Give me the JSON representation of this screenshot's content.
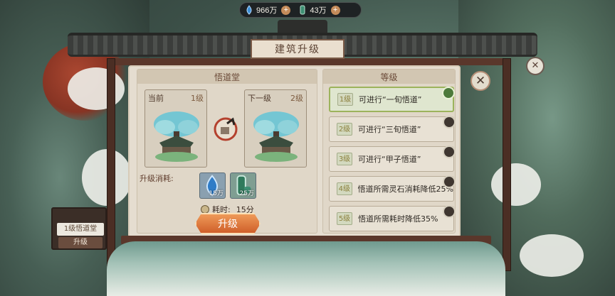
{
  "resources": [
    {
      "icon": "spirit-stone-icon",
      "value": "966万",
      "color": "#3d8fd6"
    },
    {
      "icon": "wood-log-icon",
      "value": "43万",
      "color": "#3e8f73"
    }
  ],
  "dialog": {
    "title": "建筑升级",
    "building_name": "悟道堂",
    "current_label": "当前",
    "current_level": "1级",
    "next_label": "下一级",
    "next_level": "2级",
    "cost_label": "升级消耗:",
    "costs": [
      {
        "icon": "spirit-stone-icon",
        "qty": "15万"
      },
      {
        "icon": "wood-log-icon",
        "qty": "25万"
      }
    ],
    "time_label": "耗时:",
    "time_value": "15分",
    "upgrade_button": "升级"
  },
  "levels_panel": {
    "header": "等级",
    "items": [
      {
        "level": "1级",
        "text": "可进行“一旬悟道”",
        "state": "unlocked"
      },
      {
        "level": "2级",
        "text": "可进行“三旬悟道”",
        "state": "locked"
      },
      {
        "level": "3级",
        "text": "可进行“甲子悟道”",
        "state": "locked"
      },
      {
        "level": "4级",
        "text": "悟道所需灵石消耗降低25%",
        "state": "locked"
      },
      {
        "level": "5级",
        "text": "悟道所需耗时降低35%",
        "state": "locked"
      }
    ]
  },
  "side_sign": {
    "title": "1级悟道堂",
    "button": "升级"
  },
  "close_symbol": "✕",
  "lantern_symbol": "✕"
}
